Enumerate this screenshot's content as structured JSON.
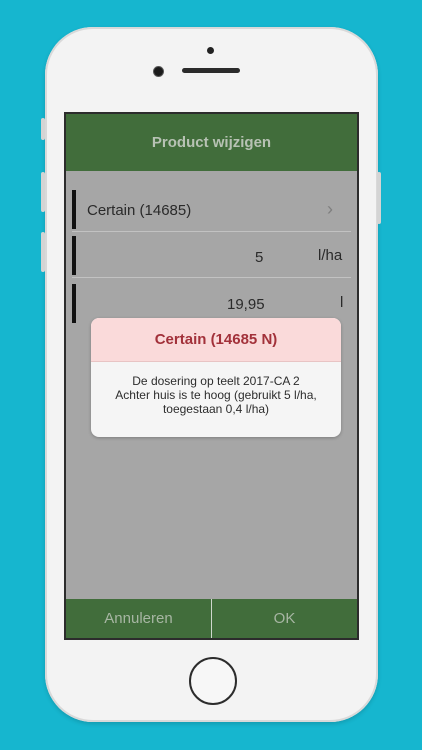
{
  "header": {
    "title": "Product wijzigen"
  },
  "product_row": {
    "label": "Certain (14685)",
    "chevron_icon": "chevron-right-icon"
  },
  "dose_row": {
    "value": "5",
    "unit": "l/ha"
  },
  "total_row": {
    "value": "19,95",
    "unit": "l"
  },
  "footer": {
    "cancel_label": "Annuleren",
    "ok_label": "OK"
  },
  "dialog": {
    "title": "Certain (14685 N)",
    "lines": [
      "De dosering op teelt 2017-CA 2",
      "Achter huis is te hoog (gebruikt 5 l/ha,",
      "toegestaan 0,4 l/ha)"
    ]
  },
  "colors": {
    "background": "#16b6cf",
    "brand_green": "#416d3b",
    "dialog_header": "#fadada",
    "dialog_title": "#a2313a"
  }
}
